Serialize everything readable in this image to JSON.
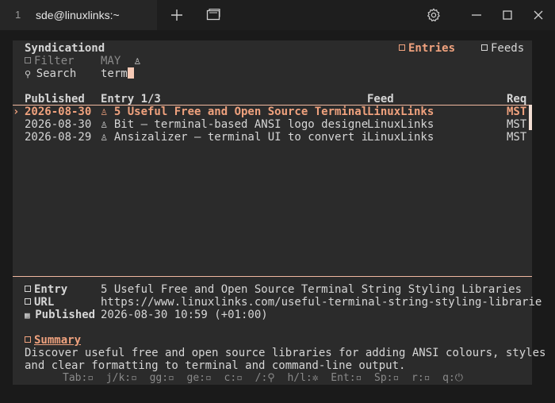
{
  "window": {
    "tab_number": "1",
    "tab_title": "sde@linuxlinks:~"
  },
  "app": {
    "name": "Syndicationd",
    "tabs": [
      {
        "label": "Entries",
        "active": true
      },
      {
        "label": "Feeds",
        "active": false
      }
    ],
    "filter": {
      "label": "Filter",
      "value": "MAY",
      "glyph": "♙"
    },
    "search": {
      "label": "Search",
      "value": "term"
    }
  },
  "table": {
    "columns": [
      "Published",
      "Entry 1/3",
      "Feed",
      "Req"
    ],
    "selected_marker": "›",
    "rows": [
      {
        "published": "2026-08-30",
        "entry": "♙ 5 Useful Free and Open Source Terminal",
        "feed": "LinuxLinks",
        "req": "MST",
        "selected": true
      },
      {
        "published": "2026-08-30",
        "entry": "♙ Bit – terminal-based ANSI logo designe",
        "feed": "LinuxLinks",
        "req": "MST",
        "selected": false
      },
      {
        "published": "2026-08-29",
        "entry": "♙ Ansizalizer – terminal UI to convert i",
        "feed": "LinuxLinks",
        "req": "MST",
        "selected": false
      }
    ]
  },
  "detail": {
    "entry_label": "Entry",
    "entry_value": "5 Useful Free and Open Source Terminal String Styling Libraries",
    "url_label": "URL",
    "url_value": "https://www.linuxlinks.com/useful-terminal-string-styling-librarie",
    "published_label": "Published",
    "published_value": "2026-08-30 10:59 (+01:00)",
    "summary_label": "Summary",
    "summary_lines": [
      "Discover useful free and open source libraries for adding ANSI colours, styles",
      "and clear formatting to terminal and command-line output."
    ]
  },
  "keybinds": "Tab:▫  j/k:▫  gg:▫  ge:▫  c:▫  /:⚲  h/l:✲  Ent:▫  Sp:▫  r:▫  q:⏻",
  "colors": {
    "accent": "#f0a27e",
    "terminal_bg": "#2b2b2b",
    "text": "#d6d6d6",
    "dim_text": "#8a8a8a"
  }
}
